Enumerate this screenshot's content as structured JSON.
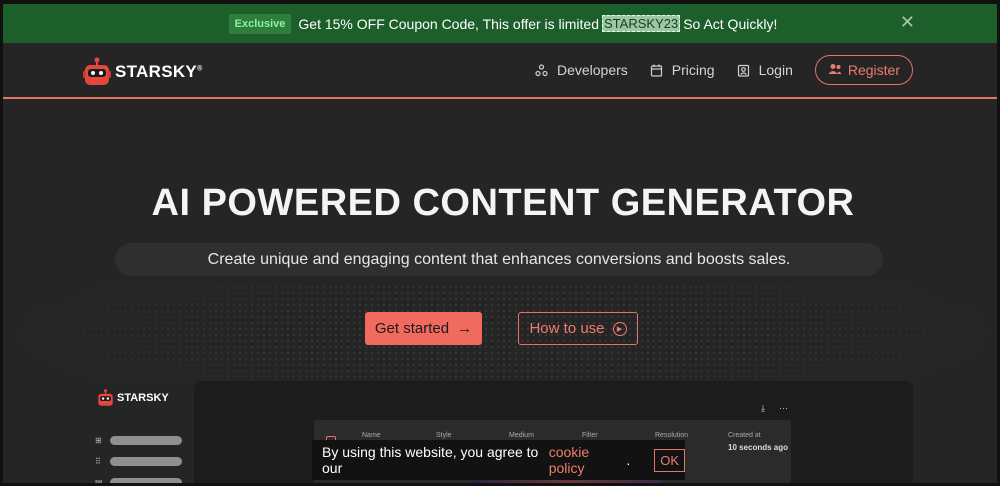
{
  "promo": {
    "tag": "Exclusive",
    "text_before": "Get 15% OFF Coupon Code, This offer is limited",
    "code": "STARSKY23",
    "text_after": "So Act Quickly!",
    "close_icon": "close-icon"
  },
  "header": {
    "brand": "STARSKY",
    "brand_mark": "®",
    "nav": [
      {
        "label": "Developers",
        "icon": "developers-icon"
      },
      {
        "label": "Pricing",
        "icon": "pricing-icon"
      },
      {
        "label": "Login",
        "icon": "login-icon"
      }
    ],
    "register": {
      "label": "Register",
      "icon": "users-icon"
    }
  },
  "hero": {
    "title": "AI POWERED CONTENT GENERATOR",
    "subtitle": "Create unique and engaging content that enhances conversions and boosts sales.",
    "start_label": "Get started",
    "how_label": "How to use"
  },
  "preview": {
    "brand": "STARSKY",
    "columns": [
      {
        "label": "Name",
        "value": ""
      },
      {
        "label": "Style",
        "value": ""
      },
      {
        "label": "Medium",
        "value": ""
      },
      {
        "label": "Filter",
        "value": ""
      },
      {
        "label": "Resolution",
        "value": ""
      },
      {
        "label": "Created at",
        "value": "10 seconds ago"
      }
    ],
    "tools": [
      "download-icon",
      "more-icon"
    ]
  },
  "cookie": {
    "text": "By using this website, you agree to our",
    "link": "cookie policy",
    "end": ".",
    "ok_label": "OK"
  },
  "colors": {
    "accent": "#f06a5e",
    "promo_bg": "#1d5f2a",
    "page_bg": "#252525"
  }
}
